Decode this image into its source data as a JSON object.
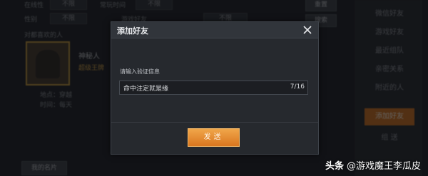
{
  "background": {
    "filter_labels": [
      "在线性",
      "性别",
      "对都喜欢的人"
    ],
    "filter_values": [
      "不限",
      "不限",
      "不限"
    ],
    "filter2_labels": [
      "常玩时间",
      "游戏好友"
    ],
    "filter2_values": [
      "不限",
      "不限"
    ],
    "reset_label": "重置",
    "search_label": "搜索",
    "player_name": "神秘人",
    "player_title": "超级王牌",
    "player_tags": [
      "地点：穿越",
      "时间：每天"
    ],
    "sidebar_items": [
      "微信好友",
      "游戏好友",
      "最近组队",
      "亲密关系",
      "附近的人",
      "添加好友",
      "组 送"
    ],
    "bottom_button": "我的名片"
  },
  "dialog": {
    "title": "添加好友",
    "prompt": "请输入验证信息",
    "message_value": "命中注定就是缘",
    "char_count": "7/16",
    "send_label": "发送"
  },
  "watermark": {
    "brand": "头条",
    "author": "@游戏魔王李瓜皮"
  }
}
